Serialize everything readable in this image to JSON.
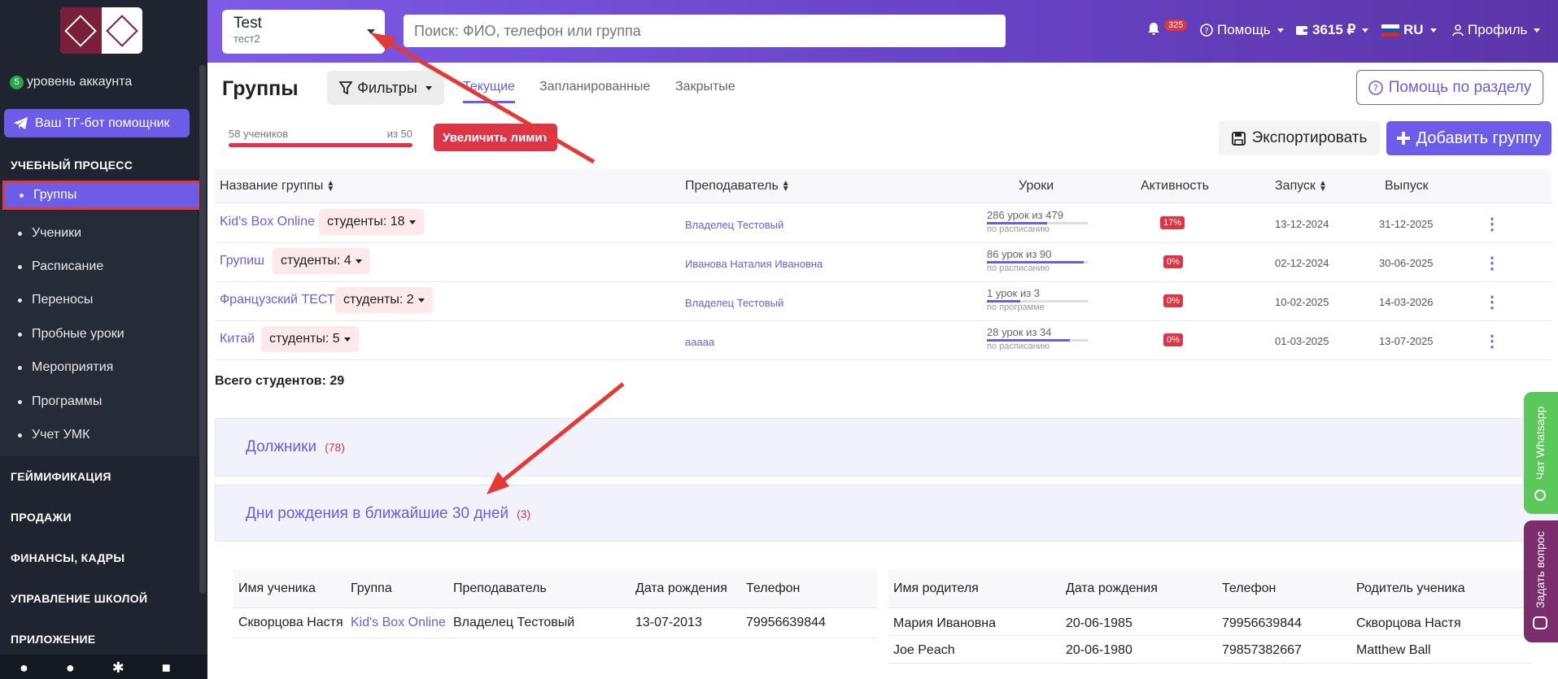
{
  "sidebar": {
    "level_num": "5",
    "level_label": "уровень аккаунта",
    "tg_button": "Ваш ТГ-бот помощник",
    "section_edu": "УЧЕБНЫЙ ПРОЦЕСС",
    "items": [
      "Группы",
      "Ученики",
      "Расписание",
      "Переносы",
      "Пробные уроки",
      "Мероприятия",
      "Программы",
      "Учет УМК"
    ],
    "sections": [
      "ГЕЙМИФИКАЦИЯ",
      "ПРОДАЖИ",
      "ФИНАНСЫ, КАДРЫ",
      "УПРАВЛЕНИЕ ШКОЛОЙ",
      "ПРИЛОЖЕНИЕ"
    ]
  },
  "header": {
    "org_name": "Test",
    "org_sub": "тест2",
    "search_placeholder": "Поиск: ФИО, телефон или группа",
    "notifications": "325",
    "help": "Помощь",
    "balance": "3615 ₽",
    "lang": "RU",
    "profile": "Профиль"
  },
  "page": {
    "title": "Группы",
    "filters": "Фильтры",
    "tabs": [
      "Текущие",
      "Запланированные",
      "Закрытые"
    ],
    "help_section": "Помощь по разделу",
    "students_count": "58 учеников",
    "limit_of": "из 50",
    "limit_progress": 1.0,
    "increase_limit": "Увеличить лимит",
    "export": "Экспортировать",
    "add_group": "Добавить группу"
  },
  "table": {
    "headers": [
      "Название группы",
      "Преподаватель",
      "Уроки",
      "Активность",
      "Запуск",
      "Выпуск"
    ],
    "rows": [
      {
        "name": "Kid's Box Online",
        "students": "студенты: 18",
        "teacher": "Владелец Тестовый",
        "lessons": "286 урок из 479",
        "lessons_sub": "по расписанию",
        "progress": 0.6,
        "activity": "17%",
        "start": "13-12-2024",
        "end": "31-12-2025"
      },
      {
        "name": "Групиш",
        "students": "студенты: 4",
        "teacher": "Иванова Наталия Ивановна",
        "lessons": "86 урок из 90",
        "lessons_sub": "по расписанию",
        "progress": 0.96,
        "activity": "0%",
        "start": "02-12-2024",
        "end": "30-06-2025"
      },
      {
        "name": "Французский ТЕСТ",
        "students": "студенты: 2",
        "teacher": "Владелец Тестовый",
        "lessons": "1 урок из 3",
        "lessons_sub": "по программе",
        "progress": 0.33,
        "activity": "0%",
        "start": "10-02-2025",
        "end": "14-03-2026"
      },
      {
        "name": "Китай",
        "students": "студенты: 5",
        "teacher": "ааааа",
        "lessons": "28 урок из 34",
        "lessons_sub": "по расписанию",
        "progress": 0.82,
        "activity": "0%",
        "start": "01-03-2025",
        "end": "13-07-2025"
      }
    ],
    "total": "Всего студентов: 29"
  },
  "debtors": {
    "title": "Должники",
    "count": "(78)"
  },
  "birthdays": {
    "title": "Дни рождения в ближайшие 30 дней",
    "count": "(3)",
    "students_headers": [
      "Имя ученика",
      "Группа",
      "Преподаватель",
      "Дата рождения",
      "Телефон"
    ],
    "students_rows": [
      {
        "name": "Скворцова Настя",
        "group": "Kid's Box Online",
        "teacher": "Владелец Тестовый",
        "birth": "13-07-2013",
        "phone": "79956639844"
      }
    ],
    "parents_headers": [
      "Имя родителя",
      "Дата рождения",
      "Телефон",
      "Родитель ученика"
    ],
    "parents_rows": [
      {
        "name": "Мария Ивановна",
        "birth": "20-06-1985",
        "phone": "79956639844",
        "child": "Скворцова Настя"
      },
      {
        "name": "Joe Peach",
        "birth": "20-06-1980",
        "phone": "79857382667",
        "child": "Matthew Ball"
      }
    ]
  },
  "side_buttons": {
    "whatsapp": "Чат Whatsapp",
    "ask": "Задать вопрос"
  },
  "colors": {
    "accent": "#6c5ce7",
    "danger": "#dc3545",
    "sidebar": "#1f2430",
    "annotation": "#e53935"
  }
}
